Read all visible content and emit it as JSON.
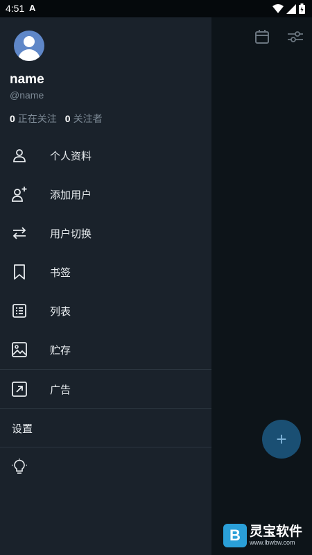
{
  "status_bar": {
    "time": "4:51",
    "app_icon": "A"
  },
  "profile": {
    "name": "name",
    "handle": "@name",
    "following_count": "0",
    "following_label": "正在关注",
    "followers_count": "0",
    "followers_label": "关注者"
  },
  "menu": [
    {
      "label": "个人资料",
      "icon": "person-icon"
    },
    {
      "label": "添加用户",
      "icon": "add-user-icon"
    },
    {
      "label": "用户切换",
      "icon": "switch-arrows-icon"
    },
    {
      "label": "书签",
      "icon": "bookmark-icon"
    },
    {
      "label": "列表",
      "icon": "list-icon"
    },
    {
      "label": "贮存",
      "icon": "image-icon"
    },
    {
      "label": "广告",
      "icon": "external-link-icon"
    }
  ],
  "settings": {
    "label": "设置"
  },
  "fab": {
    "label": "+"
  },
  "watermark": {
    "logo": "B",
    "title": "灵宝软件",
    "url": "www.lbwbw.com"
  },
  "colors": {
    "drawer_bg": "#1a222b",
    "accent": "#1a4f73",
    "text": "#e8ecef",
    "muted": "#7d8a96"
  }
}
